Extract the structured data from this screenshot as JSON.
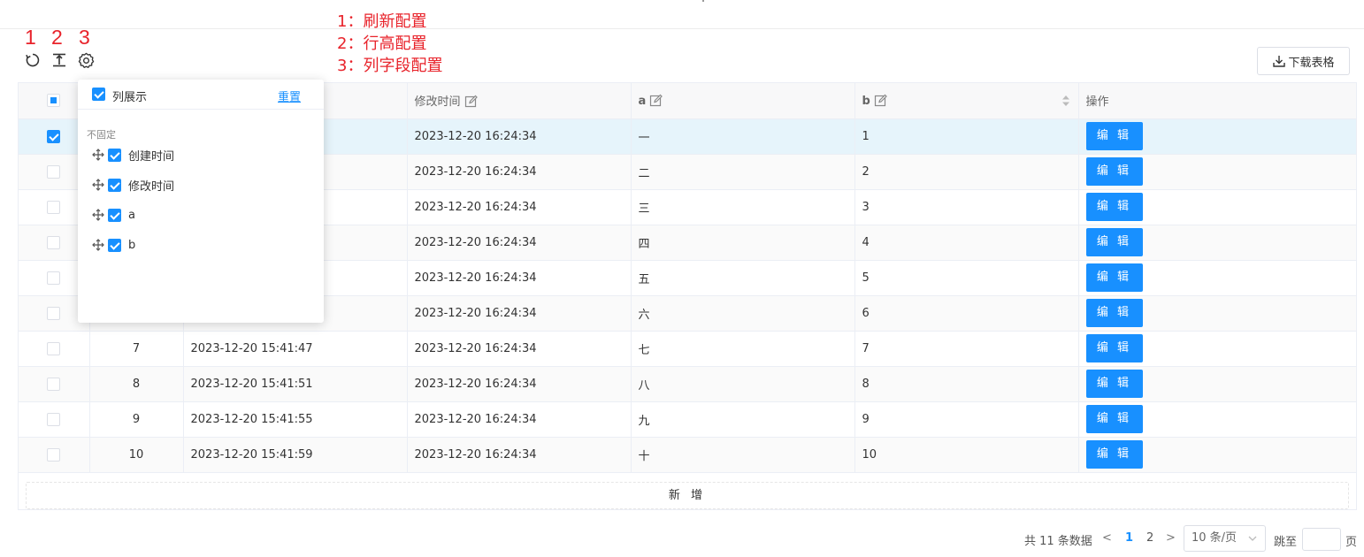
{
  "annotations": {
    "numbers": [
      "1",
      "2",
      "3"
    ],
    "legend": [
      "1：刷新配置",
      "2：行高配置",
      "3：列字段配置"
    ],
    "color": "#e8232b"
  },
  "toolbar": {
    "icons": [
      "refresh-icon",
      "row-height-icon",
      "settings-icon"
    ],
    "download_label": "下载表格"
  },
  "column_popover": {
    "title": "列展示",
    "reset_label": "重置",
    "section_label": "不固定",
    "items": [
      {
        "label": "创建时间",
        "checked": true
      },
      {
        "label": "修改时间",
        "checked": true
      },
      {
        "label": "a",
        "checked": true
      },
      {
        "label": "b",
        "checked": true
      }
    ]
  },
  "table": {
    "headers": {
      "modified": "修改时间",
      "a": "a",
      "b": "b",
      "actions": "操作"
    },
    "rows": [
      {
        "idx": "",
        "created": "",
        "modified": "2023-12-20 16:24:34",
        "a": "一",
        "b": "1",
        "selected": true
      },
      {
        "idx": "",
        "created": "",
        "modified": "2023-12-20 16:24:34",
        "a": "二",
        "b": "2",
        "selected": false
      },
      {
        "idx": "",
        "created": "",
        "modified": "2023-12-20 16:24:34",
        "a": "三",
        "b": "3",
        "selected": false
      },
      {
        "idx": "",
        "created": "",
        "modified": "2023-12-20 16:24:34",
        "a": "四",
        "b": "4",
        "selected": false
      },
      {
        "idx": "",
        "created": "",
        "modified": "2023-12-20 16:24:34",
        "a": "五",
        "b": "5",
        "selected": false
      },
      {
        "idx": "",
        "created": "",
        "modified": "2023-12-20 16:24:34",
        "a": "六",
        "b": "6",
        "selected": false
      },
      {
        "idx": "7",
        "created": "2023-12-20 15:41:47",
        "modified": "2023-12-20 16:24:34",
        "a": "七",
        "b": "7",
        "selected": false
      },
      {
        "idx": "8",
        "created": "2023-12-20 15:41:51",
        "modified": "2023-12-20 16:24:34",
        "a": "八",
        "b": "8",
        "selected": false
      },
      {
        "idx": "9",
        "created": "2023-12-20 15:41:55",
        "modified": "2023-12-20 16:24:34",
        "a": "九",
        "b": "9",
        "selected": false
      },
      {
        "idx": "10",
        "created": "2023-12-20 15:41:59",
        "modified": "2023-12-20 16:24:34",
        "a": "十",
        "b": "10",
        "selected": false
      }
    ],
    "edit_label": "编 辑",
    "add_label": "新 增"
  },
  "pagination": {
    "total": "共 11 条数据",
    "prev": "<",
    "pages": [
      "1",
      "2"
    ],
    "current": "1",
    "next": ">",
    "page_size": "10 条/页",
    "jump_label": "跳至",
    "jump_value": "",
    "page_suffix": "页"
  },
  "colors": {
    "primary": "#1890ff",
    "selected_row": "#e6f4fb",
    "annotation": "#e8232b"
  }
}
